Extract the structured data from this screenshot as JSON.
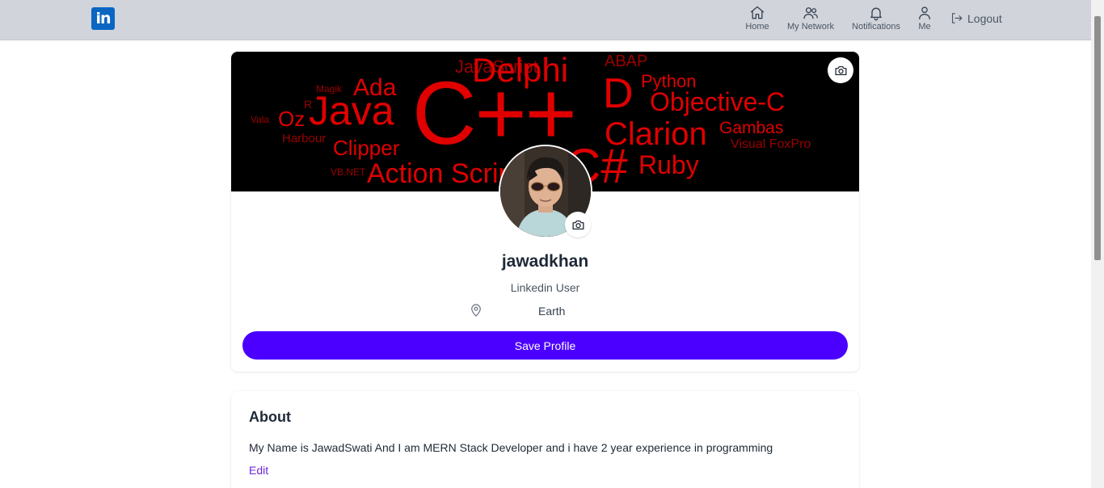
{
  "navbar": {
    "logo_text": "in",
    "items": [
      {
        "label": "Home",
        "icon": "home-icon"
      },
      {
        "label": "My Network",
        "icon": "network-icon"
      },
      {
        "label": "Notifications",
        "icon": "bell-icon"
      },
      {
        "label": "Me",
        "icon": "user-icon"
      }
    ],
    "logout_label": "Logout"
  },
  "profile": {
    "banner_words": [
      "Delphi",
      "C++",
      "Java",
      "C#",
      "JavaScript",
      "ABAP",
      "Ada",
      "Python",
      "D",
      "Objective-C",
      "Oz",
      "Clarion",
      "Gambas",
      "Visual FoxPro",
      "Clipper",
      "Harbour",
      "Action Script",
      "Ruby",
      "VB.NET",
      "Vala",
      "Magik",
      "R"
    ],
    "name": "jawadkhan",
    "headline": "Linkedin User",
    "location": "Earth",
    "save_label": "Save Profile"
  },
  "about": {
    "title": "About",
    "text": "My Name is JawadSwati And I am MERN Stack Developer and i have 2 year experience in programming",
    "edit_label": "Edit"
  },
  "colors": {
    "navbar_bg": "#d1d5db",
    "brand": "#0a66c2",
    "primary_button": "#4b00ff",
    "link": "#6d28d9"
  }
}
